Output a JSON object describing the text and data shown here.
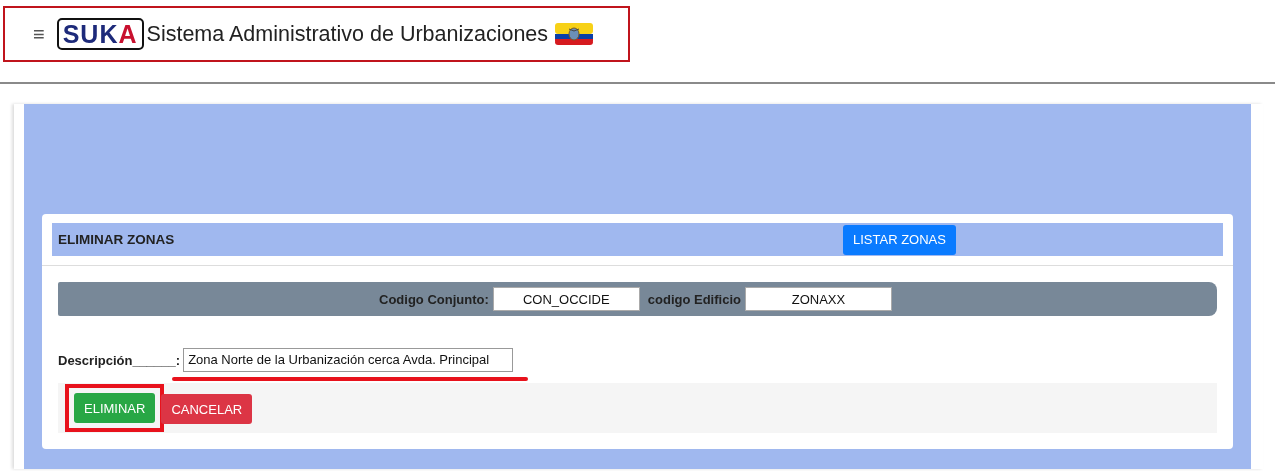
{
  "header": {
    "menu_icon": "≡",
    "logo": "SUKA",
    "title": "Sistema Administrativo de Urbanizaciones",
    "highlighted": true
  },
  "form": {
    "title": "ELIMINAR ZONAS",
    "list_button": "LISTAR ZONAS",
    "codes": [
      {
        "label": "Codigo Conjunto:",
        "value": "CON_OCCIDE"
      },
      {
        "label": "codigo Edificio",
        "value": "ZONAXX"
      }
    ],
    "description": {
      "label": "Descripción______:",
      "value": "Zona Norte de la Urbanización cerca Avda. Principal",
      "underlined": true
    },
    "buttons": [
      {
        "label": "ELIMINAR",
        "kind": "success",
        "highlighted": true
      },
      {
        "label": "CANCELAR",
        "kind": "danger",
        "highlighted": false
      }
    ]
  }
}
